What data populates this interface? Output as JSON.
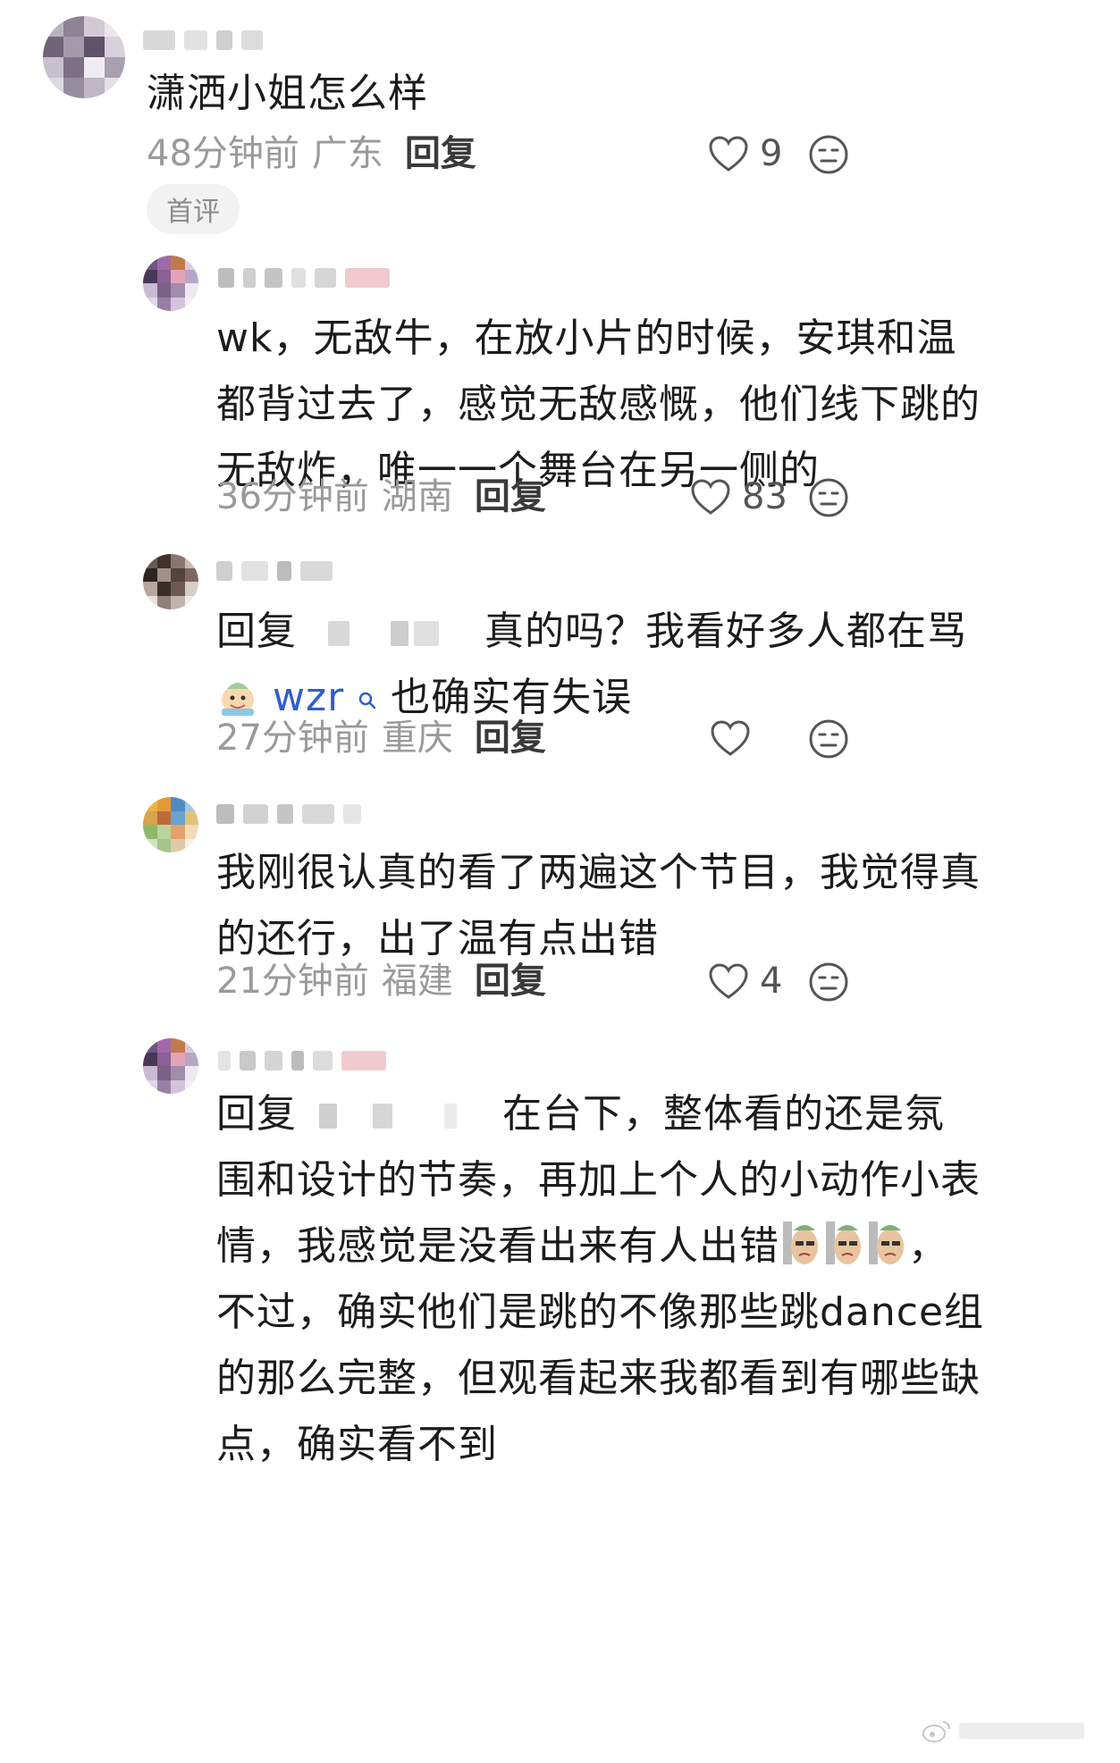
{
  "comments": [
    {
      "text": "潇洒小姐怎么样",
      "time": "48分钟前",
      "location": "广东",
      "reply_label": "回复",
      "likes": "9",
      "badge": "首评"
    },
    {
      "lines": [
        "wk，无敌牛，在放小片的时候，安琪和温",
        "都背过去了，感觉无敌感慨，他们线下跳的",
        "无敌炸，唯一一个舞台在另一侧的"
      ],
      "time": "36分钟前",
      "location": "湖南",
      "reply_label": "回复",
      "likes": "83"
    },
    {
      "reply_prefix": "回复",
      "line1_rest": "真的吗？我看好多人都在骂",
      "mention": "wzr",
      "line2_rest": "也确实有失误",
      "time": "27分钟前",
      "location": "重庆",
      "reply_label": "回复",
      "likes": ""
    },
    {
      "lines": [
        "我刚很认真的看了两遍这个节目，我觉得真",
        "的还行，出了温有点出错"
      ],
      "time": "21分钟前",
      "location": "福建",
      "reply_label": "回复",
      "likes": "4"
    },
    {
      "reply_prefix": "回复",
      "line1_rest": "在台下，整体看的还是氛",
      "line2": "围和设计的节奏，再加上个人的小动作小表",
      "line3_start": "情，我感觉是没看出来有人出错",
      "line3_end": "，",
      "line4": "不过，确实他们是跳的不像那些跳dance组",
      "line5": "的那么完整，但观看起来我都看到有哪些缺",
      "line6": "点，确实看不到"
    }
  ],
  "icons": {
    "like": "heart-outline-icon",
    "emoji": "emoji-face-icon",
    "search": "search-icon",
    "sticker": "sticker-emoji-icon"
  },
  "colors": {
    "accent_blue": "#2f5fc9",
    "meta_gray": "#9a9a9a",
    "text": "#1c1c1c"
  }
}
